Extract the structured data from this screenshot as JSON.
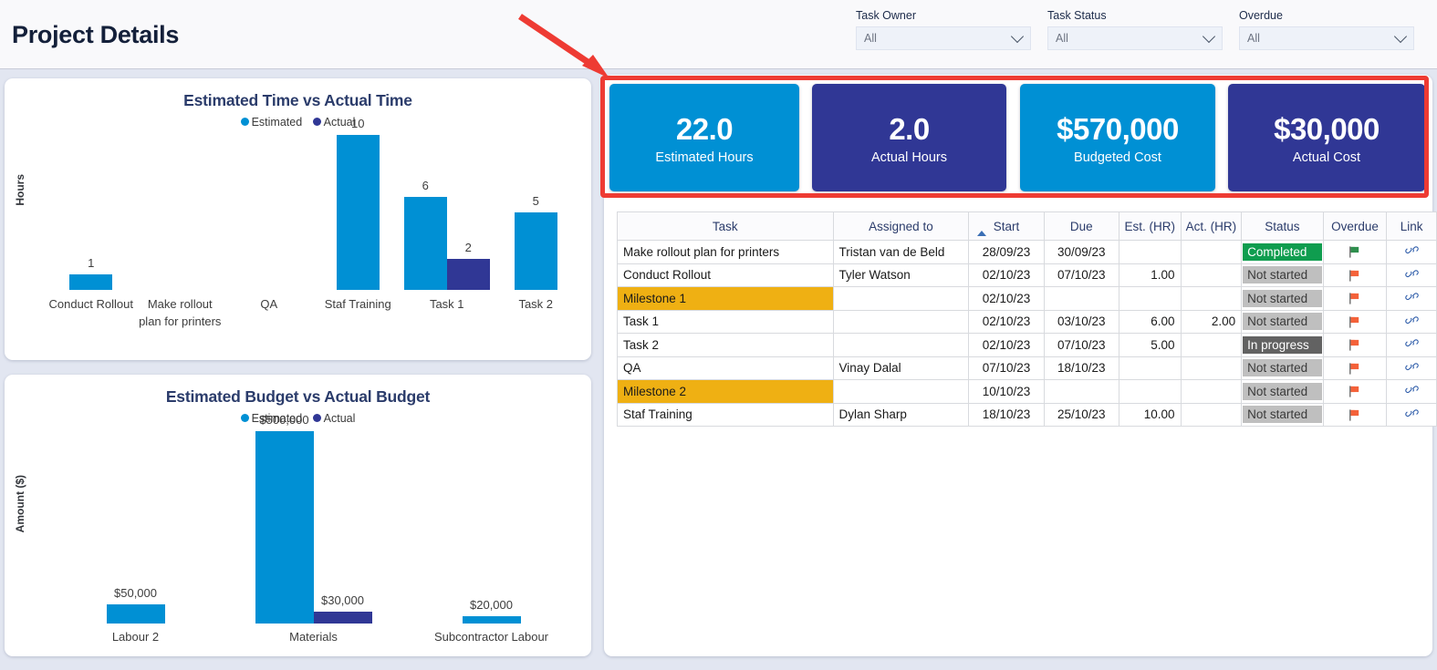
{
  "header": {
    "title": "Project Details",
    "filters": [
      {
        "label": "Task Owner",
        "value": "All",
        "icon": "chevron-down-icon"
      },
      {
        "label": "Task Status",
        "value": "All",
        "icon": "chevron-down-icon"
      },
      {
        "label": "Overdue",
        "value": "All",
        "icon": "chevron-down-icon"
      }
    ]
  },
  "colors": {
    "estimated": "#0090d4",
    "actual": "#303795",
    "milestone": "#efb013",
    "completed": "#0f9d4f",
    "not_started": "#bfbfbf",
    "in_progress": "#626262",
    "annotation": "#ee3b33",
    "page_bg": "#e2e6f1",
    "title": "#2b3c6b"
  },
  "kpi_cards": [
    {
      "value": "22.0",
      "label": "Estimated Hours",
      "color": "#0090d4"
    },
    {
      "value": "2.0",
      "label": "Actual Hours",
      "color": "#303795"
    },
    {
      "value": "$570,000",
      "label": "Budgeted Cost",
      "color": "#0090d4"
    },
    {
      "value": "$30,000",
      "label": "Actual Cost",
      "color": "#303795"
    }
  ],
  "annotation": {
    "shape": "rectangle",
    "arrow": "arrow-pointing-to-kpi-cards",
    "color": "#ee3b33"
  },
  "chart_data": [
    {
      "type": "bar",
      "title": "Estimated Time vs Actual Time",
      "xlabel": "",
      "ylabel": "Hours",
      "legend": [
        "Estimated",
        "Actual"
      ],
      "legend_position": "top",
      "grid": false,
      "ylim": [
        0,
        10
      ],
      "categories": [
        "Conduct Rollout",
        "Make rollout plan for printers",
        "QA",
        "Staf Training",
        "Task 1",
        "Task 2"
      ],
      "series": [
        {
          "name": "Estimated",
          "color": "#0090d4",
          "values": [
            1,
            null,
            null,
            10,
            6,
            5
          ],
          "labels": [
            "1",
            "",
            "",
            "10",
            "6",
            "5"
          ]
        },
        {
          "name": "Actual",
          "color": "#303795",
          "values": [
            null,
            null,
            null,
            null,
            2,
            null
          ],
          "labels": [
            "",
            "",
            "",
            "",
            "2",
            ""
          ]
        }
      ]
    },
    {
      "type": "bar",
      "title": "Estimated Budget vs Actual Budget",
      "xlabel": "",
      "ylabel": "Amount ($)",
      "legend": [
        "Estimated",
        "Actual"
      ],
      "legend_position": "top",
      "grid": false,
      "ylim": [
        0,
        500000
      ],
      "categories": [
        "Labour 2",
        "Materials",
        "Subcontractor Labour"
      ],
      "series": [
        {
          "name": "Estimated",
          "color": "#0090d4",
          "values": [
            50000,
            500000,
            20000
          ],
          "labels": [
            "$50,000",
            "$500,000",
            "$20,000"
          ]
        },
        {
          "name": "Actual",
          "color": "#303795",
          "values": [
            null,
            30000,
            null
          ],
          "labels": [
            "",
            "$30,000",
            ""
          ]
        }
      ]
    }
  ],
  "table": {
    "columns": [
      "Task",
      "Assigned to",
      "Start",
      "Due",
      "Est. (HR)",
      "Act. (HR)",
      "Status",
      "Overdue",
      "Link"
    ],
    "sorted_column": "Start",
    "sort_direction": "ascending",
    "rows": [
      {
        "task": "Make rollout plan for printers",
        "assigned": "Tristan van de Beld",
        "start": "28/09/23",
        "due": "30/09/23",
        "est": "",
        "act": "",
        "status": "Completed",
        "status_kind": "completed",
        "overdue": "green-flag-icon",
        "link": "link-icon",
        "milestone": false
      },
      {
        "task": "Conduct Rollout",
        "assigned": "Tyler Watson",
        "start": "02/10/23",
        "due": "07/10/23",
        "est": "1.00",
        "act": "",
        "status": "Not started",
        "status_kind": "not-started",
        "overdue": "red-flag-icon",
        "link": "link-icon",
        "milestone": false
      },
      {
        "task": "Milestone 1",
        "assigned": "",
        "start": "02/10/23",
        "due": "",
        "est": "",
        "act": "",
        "status": "Not started",
        "status_kind": "not-started",
        "overdue": "red-flag-icon",
        "link": "link-icon",
        "milestone": true
      },
      {
        "task": "Task 1",
        "assigned": "",
        "start": "02/10/23",
        "due": "03/10/23",
        "est": "6.00",
        "act": "2.00",
        "status": "Not started",
        "status_kind": "not-started",
        "overdue": "red-flag-icon",
        "link": "link-icon",
        "milestone": false
      },
      {
        "task": "Task 2",
        "assigned": "",
        "start": "02/10/23",
        "due": "07/10/23",
        "est": "5.00",
        "act": "",
        "status": "In progress",
        "status_kind": "in-progress",
        "overdue": "red-flag-icon",
        "link": "link-icon",
        "milestone": false
      },
      {
        "task": "QA",
        "assigned": "Vinay Dalal",
        "start": "07/10/23",
        "due": "18/10/23",
        "est": "",
        "act": "",
        "status": "Not started",
        "status_kind": "not-started",
        "overdue": "red-flag-icon",
        "link": "link-icon",
        "milestone": false
      },
      {
        "task": "Milestone 2",
        "assigned": "",
        "start": "10/10/23",
        "due": "",
        "est": "",
        "act": "",
        "status": "Not started",
        "status_kind": "not-started",
        "overdue": "red-flag-icon",
        "link": "link-icon",
        "milestone": true
      },
      {
        "task": "Staf Training",
        "assigned": "Dylan Sharp",
        "start": "18/10/23",
        "due": "25/10/23",
        "est": "10.00",
        "act": "",
        "status": "Not started",
        "status_kind": "not-started",
        "overdue": "red-flag-icon",
        "link": "link-icon",
        "milestone": false
      }
    ]
  }
}
